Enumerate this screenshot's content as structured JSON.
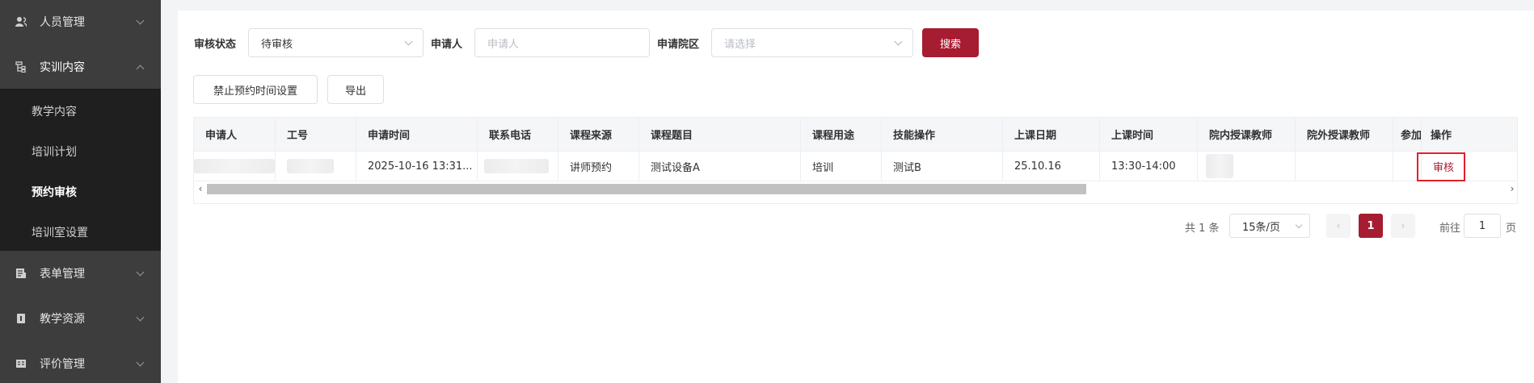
{
  "sidebar": {
    "items": [
      {
        "label": "人员管理",
        "icon": "users-icon"
      },
      {
        "label": "实训内容",
        "icon": "tree-icon"
      },
      {
        "label": "表单管理",
        "icon": "form-icon"
      },
      {
        "label": "教学资源",
        "icon": "book-icon"
      },
      {
        "label": "评价管理",
        "icon": "evaluation-icon"
      }
    ],
    "submenu": [
      {
        "label": "教学内容"
      },
      {
        "label": "培训计划"
      },
      {
        "label": "预约审核",
        "active": true
      },
      {
        "label": "培训室设置"
      }
    ]
  },
  "filters": {
    "status_label": "审核状态",
    "status_value": "待审核",
    "applicant_label": "申请人",
    "applicant_placeholder": "申请人",
    "campus_label": "申请院区",
    "campus_placeholder": "请选择",
    "search_button": "搜索"
  },
  "toolbar": {
    "forbid_time_button": "禁止预约时间设置",
    "export_button": "导出"
  },
  "table": {
    "columns": [
      "申请人",
      "工号",
      "申请时间",
      "联系电话",
      "课程来源",
      "课程题目",
      "课程用途",
      "技能操作",
      "上课日期",
      "上课时间",
      "院内授课教师",
      "院外授课教师",
      "参加",
      "操作"
    ],
    "rows": [
      {
        "apply_time": "2025-10-16 13:31...",
        "source": "讲师预约",
        "title": "测试设备A",
        "purpose": "培训",
        "skill": "测试B",
        "date": "25.10.16",
        "time": "13:30-14:00",
        "action": "审核"
      }
    ]
  },
  "pagination": {
    "total": "共 1 条",
    "page_size": "15条/页",
    "current_page": "1",
    "goto_label": "前往",
    "goto_value": "1",
    "page_suffix": "页"
  },
  "colors": {
    "sidebar_bg": "#3d3d3d",
    "submenu_bg": "#1f1f1f",
    "accent": "#a61c31",
    "highlight_border": "#e0202a"
  }
}
